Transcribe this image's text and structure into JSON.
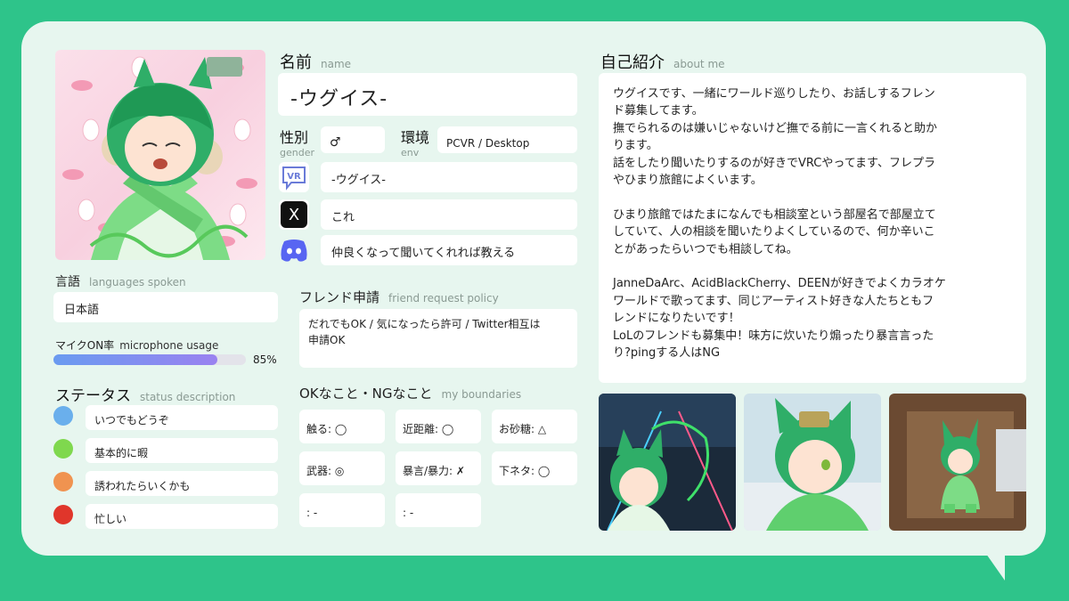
{
  "colors": {
    "background": "#2ec48a",
    "card": "#e7f6ef",
    "status_blue": "#6aafec",
    "status_green": "#7fd84e",
    "status_orange": "#f09350",
    "status_red": "#e0362b",
    "mic_bar": "#8d8cf0"
  },
  "name": {
    "title": "名前",
    "sub": "name",
    "value": "-ウグイス-"
  },
  "gender": {
    "title": "性別",
    "sub": "gender",
    "value": "♂"
  },
  "env": {
    "title": "環境",
    "sub": "env",
    "value": "PCVR / Desktop"
  },
  "social": [
    {
      "icon": "vrchat-icon",
      "icon_text": "VR",
      "value": "-ウグイス-"
    },
    {
      "icon": "x-icon",
      "icon_text": "X",
      "value": "これ"
    },
    {
      "icon": "discord-icon",
      "icon_text": "",
      "value": "仲良くなって聞いてくれれば教える"
    }
  ],
  "languages": {
    "title": "言語",
    "sub": "languages spoken",
    "value": "日本語"
  },
  "mic": {
    "title": "マイクON率",
    "sub": "microphone usage",
    "percent_label": "85%",
    "level": 0.85
  },
  "status": {
    "title": "ステータス",
    "sub": "status description",
    "items": [
      {
        "label": "いつでもどうぞ"
      },
      {
        "label": "基本的に暇"
      },
      {
        "label": "誘われたらいくかも"
      },
      {
        "label": "忙しい"
      }
    ]
  },
  "friend_request": {
    "title": "フレンド申請",
    "sub": "friend request policy",
    "line1": "だれでもOK / 気になったら許可 / Twitter相互は",
    "line2": "申請OK"
  },
  "boundaries": {
    "title": "OKなこと・NGなこと",
    "sub": "my boundaries",
    "items": [
      "触る: ◯",
      "近距離: ◯",
      "お砂糖: △",
      "武器: ◎",
      "暴言/暴力: ✗",
      "下ネタ: ◯",
      ": -",
      ": -"
    ]
  },
  "about": {
    "title": "自己紹介",
    "sub": "about me",
    "lines": [
      "ウグイスです、一緒にワールド巡りしたり、お話しするフレン",
      "ド募集してます。",
      "撫でられるのは嫌いじゃないけど撫でる前に一言くれると助か",
      "ります。",
      "話をしたり聞いたりするのが好きでVRCやってます、フレプラ",
      "やひまり旅館によくいます。",
      "",
      "ひまり旅館ではたまになんでも相談室という部屋名で部屋立て",
      "していて、人の相談を聞いたりよくしているので、何か辛いこ",
      "とがあったらいつでも相談してね。",
      "",
      "JanneDaArc、AcidBlackCherry、DEENが好きでよくカラオケ",
      "ワールドで歌ってます、同じアーティスト好きな人たちともフ",
      "レンドになりたいです！",
      "LoLのフレンドも募集中！味方に炊いたり煽ったり暴言言った",
      "り?pingする人はNG"
    ]
  }
}
